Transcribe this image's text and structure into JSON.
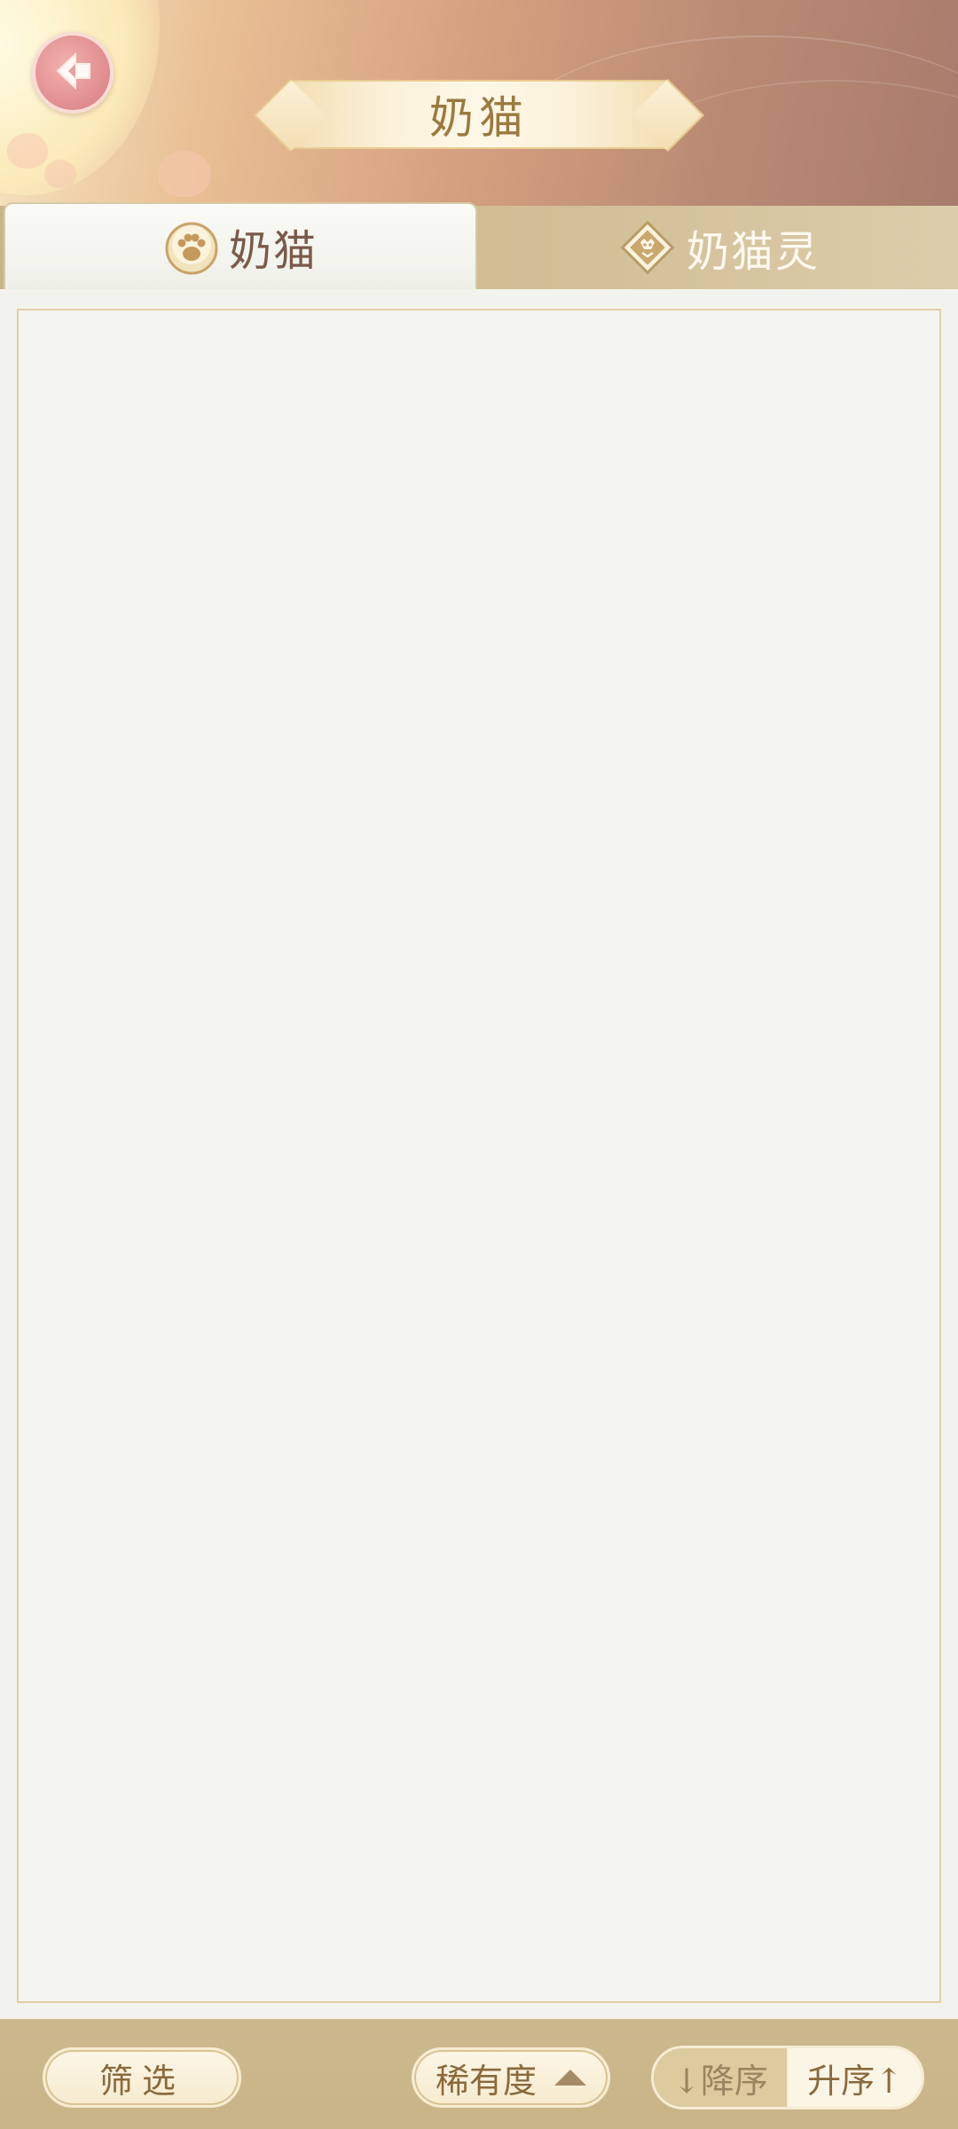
{
  "header": {
    "title": "奶猫",
    "back_icon": "arrow-left-icon"
  },
  "tabs": [
    {
      "label": "奶猫",
      "icon": "paw-icon",
      "active": true
    },
    {
      "label": "奶猫灵",
      "icon": "diamond-cat-icon",
      "active": false
    }
  ],
  "content": {
    "items": []
  },
  "bottom_bar": {
    "filter_label": "筛选",
    "sort_key_label": "稀有度",
    "sort_key_icon": "triangle-up-icon",
    "sort_desc_label": "↓降序",
    "sort_asc_label": "升序↑"
  },
  "colors": {
    "accent_gold": "#9b7a3f",
    "back_button": "#e08c8e",
    "panel_background": "#f4f4ef",
    "bar_background": "#cdb98f"
  }
}
